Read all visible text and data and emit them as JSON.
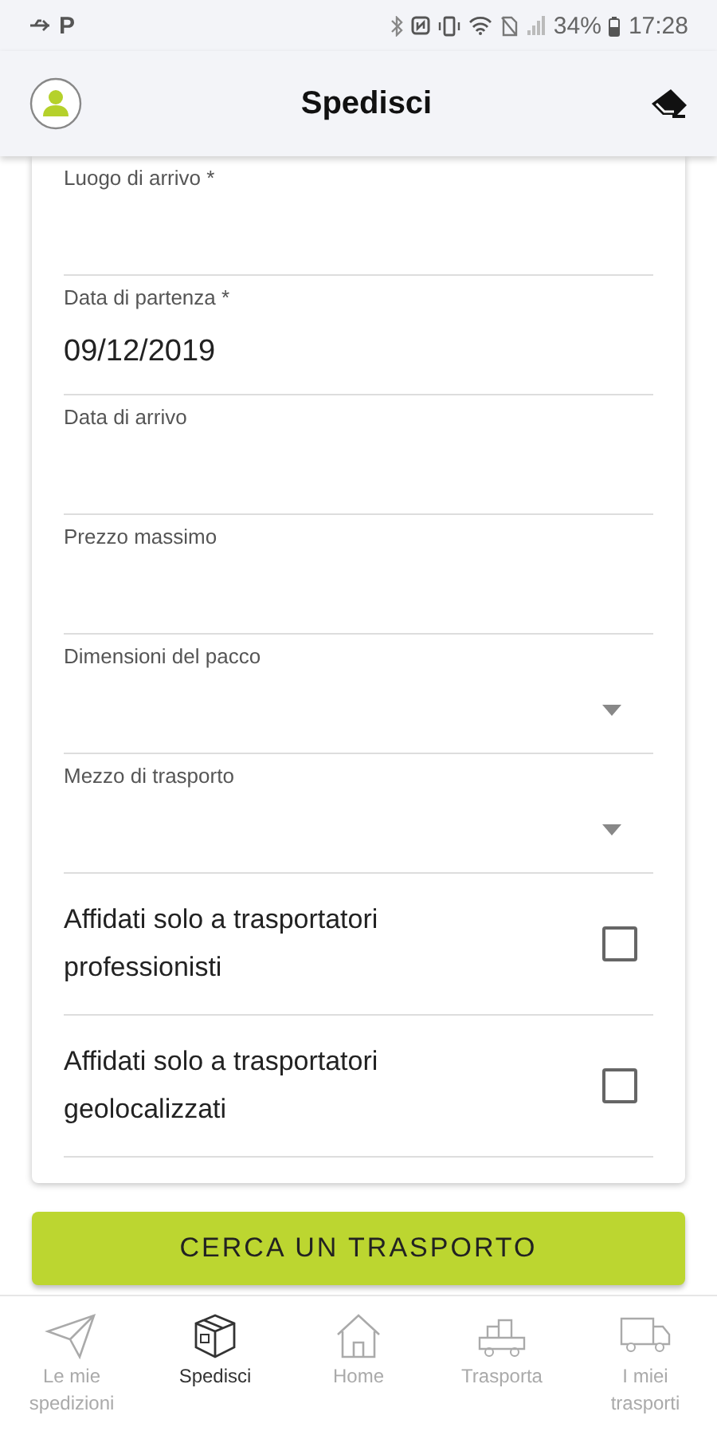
{
  "status_bar": {
    "notification_letter": "P",
    "battery": "34%",
    "time": "17:28"
  },
  "header": {
    "title": "Spedisci"
  },
  "fields": [
    {
      "kind": "text",
      "label": "Luogo di arrivo *"
    },
    {
      "kind": "text",
      "label": "Data di partenza *",
      "value": "09/12/2019"
    },
    {
      "kind": "text",
      "label": "Data di arrivo"
    },
    {
      "kind": "text",
      "label": "Prezzo massimo"
    },
    {
      "kind": "select",
      "label": "Dimensioni del pacco"
    },
    {
      "kind": "select",
      "label": "Mezzo di trasporto"
    },
    {
      "kind": "checkbox",
      "label": "Affidati solo a trasportatori professionisti",
      "checked": false
    },
    {
      "kind": "checkbox",
      "label": "Affidati solo a trasportatori geolocalizzati",
      "checked": false
    }
  ],
  "search_button": "CERCA UN TRASPORTO",
  "bottom_nav": [
    {
      "label": "Le mie spedizioni",
      "selected": false
    },
    {
      "label": "Spedisci",
      "selected": true
    },
    {
      "label": "Home",
      "selected": false
    },
    {
      "label": "Trasporta",
      "selected": false
    },
    {
      "label": "I miei trasporti",
      "selected": false
    }
  ]
}
